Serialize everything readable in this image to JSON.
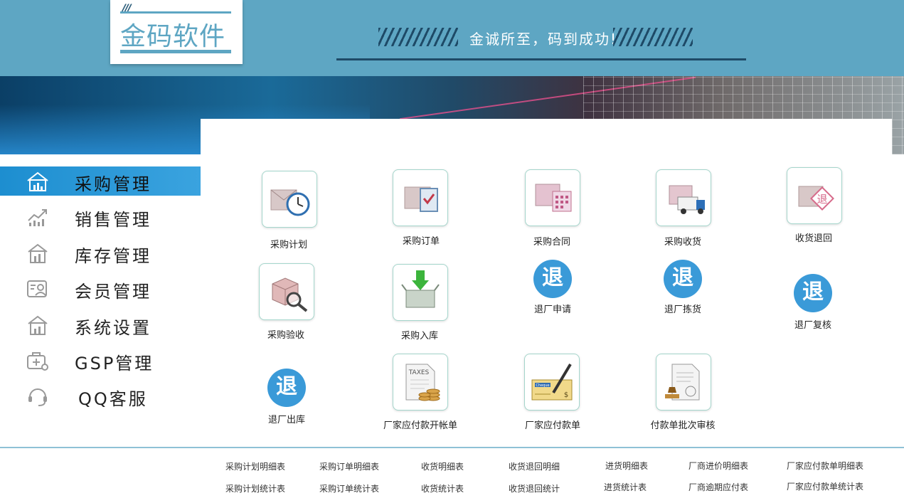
{
  "header": {
    "logo_text": "金码软件",
    "logo_slash": "///",
    "slogan": "金诚所至，码到成功!"
  },
  "sidebar": {
    "items": [
      {
        "label": "采购管理",
        "icon": "home-chart-icon",
        "active": true
      },
      {
        "label": "销售管理",
        "icon": "trend-chart-icon",
        "active": false
      },
      {
        "label": "库存管理",
        "icon": "warehouse-icon",
        "active": false
      },
      {
        "label": "会员管理",
        "icon": "member-card-icon",
        "active": false
      },
      {
        "label": "系统设置",
        "icon": "settings-building-icon",
        "active": false
      },
      {
        "label": "GSP管理",
        "icon": "medical-bag-icon",
        "active": false
      },
      {
        "label": "QQ客服",
        "icon": "headset-icon",
        "active": false
      }
    ]
  },
  "modules": [
    {
      "label": "采购计划",
      "icon": "envelope-clock-icon"
    },
    {
      "label": "采购订单",
      "icon": "envelope-order-icon"
    },
    {
      "label": "采购合同",
      "icon": "envelope-calendar-icon"
    },
    {
      "label": "采购收货",
      "icon": "envelope-truck-icon"
    },
    {
      "label": "收货退回",
      "icon": "envelope-return-icon"
    },
    {
      "label": "采购验收",
      "icon": "box-magnifier-icon"
    },
    {
      "label": "采购入库",
      "icon": "box-arrow-in-icon"
    },
    {
      "label": "退厂申请",
      "icon": "return-circle-icon",
      "glyph": "退"
    },
    {
      "label": "退厂拣货",
      "icon": "return-circle-icon",
      "glyph": "退"
    },
    {
      "label": "退厂复核",
      "icon": "return-circle-icon",
      "glyph": "退"
    },
    {
      "label": "退厂出库",
      "icon": "return-circle-icon",
      "glyph": "退"
    },
    {
      "label": "厂家应付款开帐单",
      "icon": "taxes-coins-icon",
      "badge": "TAXES"
    },
    {
      "label": "厂家应付款单",
      "icon": "cheque-pen-icon",
      "badge": "Cheque"
    },
    {
      "label": "付款单批次审核",
      "icon": "document-stamp-icon"
    }
  ],
  "reports": {
    "row1": [
      "采购计划明细表",
      "采购订单明细表",
      "收货明细表",
      "收货退回明细",
      "进货明细表",
      "厂商进价明细表",
      "厂家应付款单明细表"
    ],
    "row2": [
      "采购计划统计表",
      "采购订单统计表",
      "收货统计表",
      "收货退回统计",
      "进货统计表",
      "厂商逾期应付表",
      "厂家应付款单统计表"
    ]
  },
  "colors": {
    "header": "#5ea6c3",
    "active_nav": "#1d8ed0",
    "circle": "#3a9ad8",
    "tile_border": "#a5d6cc"
  }
}
